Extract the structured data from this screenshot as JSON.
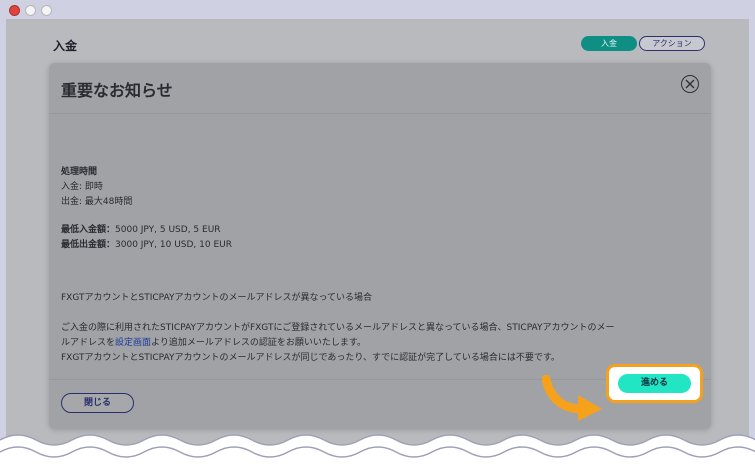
{
  "page": {
    "title": "入金"
  },
  "segmented": {
    "active_label": "入金",
    "other_label": "アクション"
  },
  "modal": {
    "title": "重要なお知らせ",
    "processing": {
      "heading": "処理時間",
      "deposit_line": "入金: 即時",
      "withdraw_line": "出金: 最大48時間"
    },
    "minimums": {
      "deposit_label": "最低入金額：",
      "deposit_value": "5000 JPY, 5 USD, 5 EUR",
      "withdraw_label": "最低出金額：",
      "withdraw_value": "3000 JPY, 10 USD, 10 EUR"
    },
    "notice": {
      "heading": "FXGTアカウントとSTICPAYアカウントのメールアドレスが異なっている場合",
      "para1_line1": "ご入金の際に利用されたSTICPAYアカウントがFXGTにご登録されているメールアドレスと異なっている場合、STICPAYアカウントのメー",
      "para1_line2_pre": "ルアドレスを",
      "para1_link": "設定画面",
      "para1_line2_post": "より追加メールアドレスの認証をお願いいたします。",
      "para2": "FXGTアカウントとSTICPAYアカウントのメールアドレスが同じであったり、すでに認証が完了している場合には不要です。"
    },
    "buttons": {
      "close_label": "閉じる",
      "proceed_label": "進める"
    }
  },
  "colors": {
    "accent_teal": "#22e6c3",
    "highlight_orange": "#f5a11c",
    "navy": "#27306b"
  }
}
